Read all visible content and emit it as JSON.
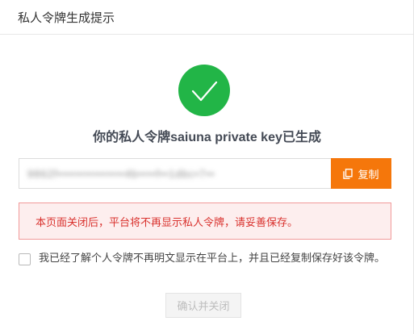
{
  "dialog": {
    "title": "私人令牌生成提示"
  },
  "status": {
    "icon": "check-circle-icon",
    "color": "#22b547",
    "heading": "你的私人令牌saiuna private key已生成"
  },
  "key_field": {
    "value": "9862f•••••••••••••••4b••••f••1dbc•7••"
  },
  "copy_button": {
    "label": "复制",
    "icon": "copy-icon",
    "color": "#f5770b"
  },
  "warning": {
    "text": "本页面关闭后，平台将不再显示私人令牌，请妥善保存。"
  },
  "confirm": {
    "checked": false,
    "text": "我已经了解个人令牌不再明文显示在平台上，并且已经复制保存好该令牌。"
  },
  "close_button": {
    "label": "确认并关闭",
    "disabled": true
  }
}
